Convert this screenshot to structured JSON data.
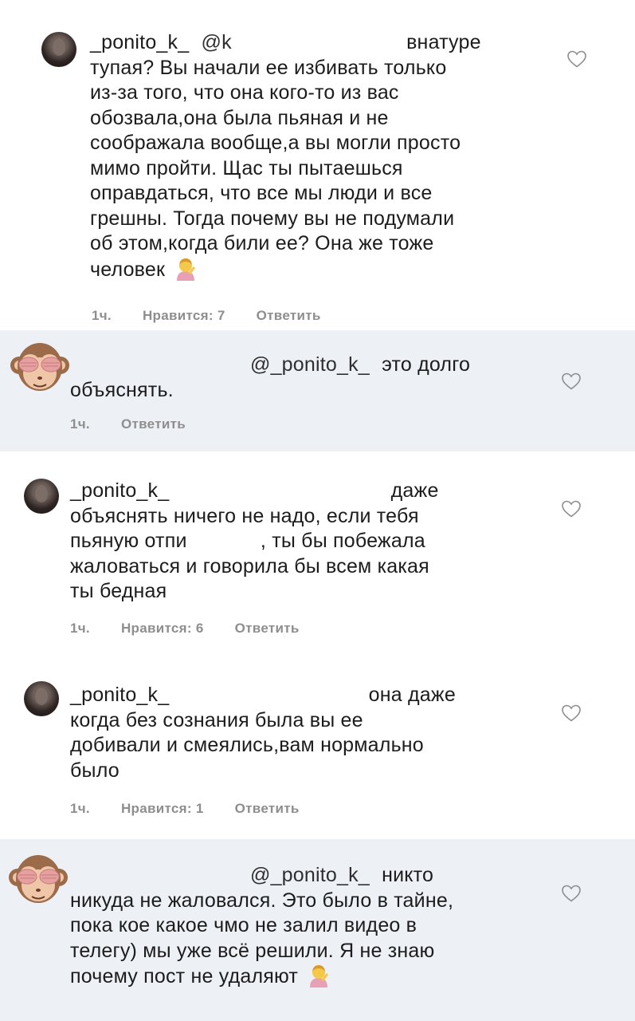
{
  "comments": [
    {
      "username": "_ponito_k_",
      "mention": "@k",
      "lines": [
        "внатуре",
        "тупая? Вы начали ее избивать только",
        "из-за того, что она кого-то из вас",
        "обозвала,она была пьяная и не",
        "соображала вообще,а вы могли просто",
        "мимо пройти. Щас ты пытаешься",
        "оправдаться, что все мы люди и все",
        "грешны. Тогда почему вы не подумали",
        "об этом,когда били ее? Она же тоже",
        "человек"
      ],
      "time": "1ч.",
      "likes": "Нравится: 7",
      "reply": "Ответить"
    },
    {
      "mention": "@_ponito_k_",
      "lines": [
        "это долго",
        "объяснять."
      ],
      "time": "1ч.",
      "reply": "Ответить"
    },
    {
      "username": "_ponito_k_",
      "lines": [
        "даже",
        "объяснять ничего не надо, если тебя",
        "пьяную отпи",
        ", ты бы побежала",
        "жаловаться и говорила бы всем какая",
        "ты бедная"
      ],
      "time": "1ч.",
      "likes": "Нравится: 6",
      "reply": "Ответить"
    },
    {
      "username": "_ponito_k_",
      "lines": [
        "она даже",
        "когда без сознания была вы ее",
        "добивали и смеялись,вам нормально",
        "было"
      ],
      "time": "1ч.",
      "likes": "Нравится: 1",
      "reply": "Ответить"
    },
    {
      "mention": "@_ponito_k_",
      "lines": [
        "никто",
        "никуда не жаловался. Это было в тайне,",
        "пока кое какое чмо не залил видео в",
        "телегу) мы уже всё решили. Я не знаю",
        "почему пост не удаляют"
      ]
    }
  ],
  "icons": {
    "heart": "heart-outline-icon",
    "monkey": "see-no-evil-monkey-emoji",
    "facepalm": "woman-tipping-hand-emoji"
  }
}
